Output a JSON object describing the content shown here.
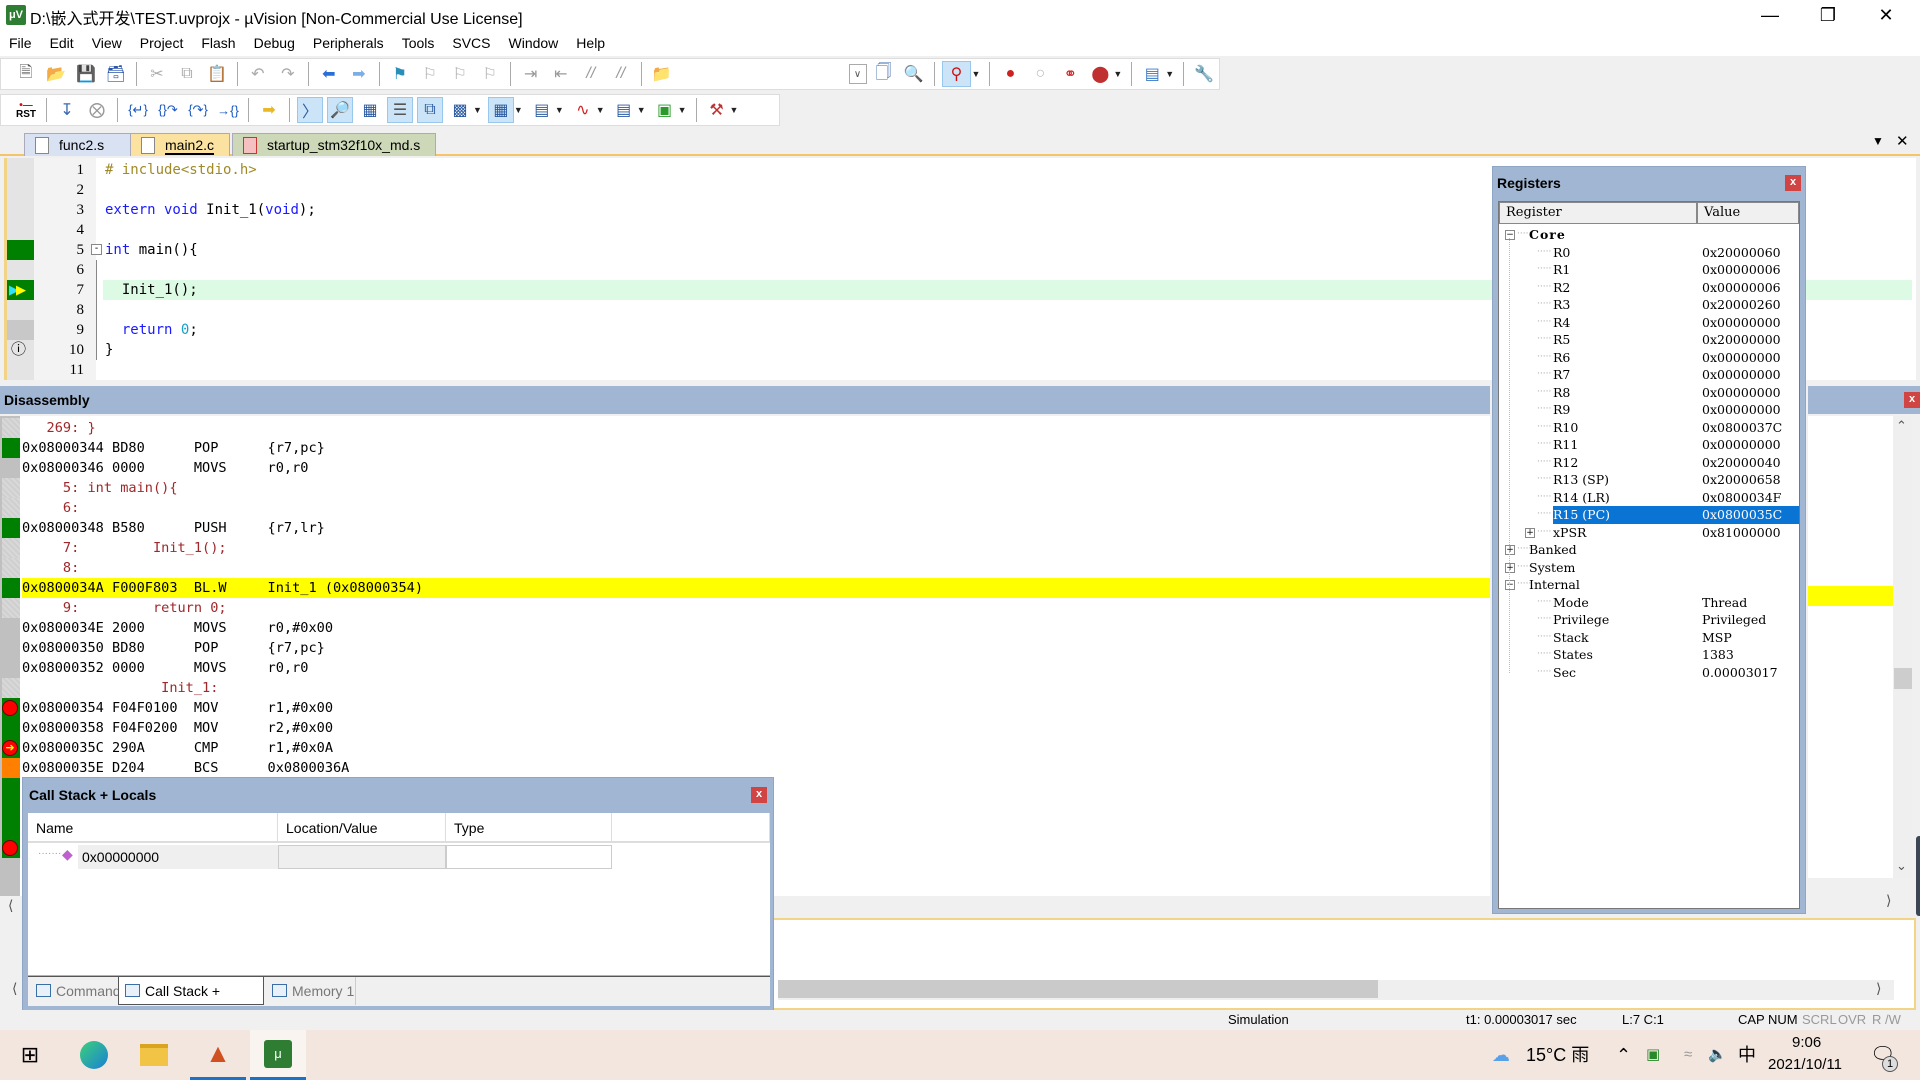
{
  "window": {
    "app_icon": "uvision-icon",
    "title": "D:\\嵌入式开发\\TEST.uvprojx - µVision  [Non-Commercial Use License]",
    "controls": [
      "minimize",
      "restore",
      "close"
    ]
  },
  "menubar": {
    "items": [
      "File",
      "Edit",
      "View",
      "Project",
      "Flash",
      "Debug",
      "Peripherals",
      "Tools",
      "SVCS",
      "Window",
      "Help"
    ]
  },
  "toolbar_file": {
    "icons": [
      "new-file-icon",
      "open-folder-icon",
      "save-icon",
      "save-all-icon",
      "cut-icon",
      "copy-icon",
      "paste-icon",
      "undo-icon",
      "redo-icon",
      "nav-back-icon",
      "nav-forward-icon",
      "bookmark-icon",
      "prev-bookmark-icon",
      "next-bookmark-icon",
      "clear-bookmarks-icon",
      "indent-icon",
      "unindent-icon",
      "comment-icon",
      "uncomment-icon",
      "find-in-files-icon",
      "find-combo",
      "incremental-find-icon",
      "find-icon",
      "debug-session-icon",
      "breakpoint-insert-icon",
      "breakpoint-disable-icon",
      "breakpoint-disable-all-icon",
      "breakpoint-kill-all-icon",
      "window-layout-icon",
      "configure-icon"
    ]
  },
  "toolbar_debug": {
    "icons": [
      "reset-icon",
      "run-icon",
      "stop-icon",
      "step-into-icon",
      "step-over-icon",
      "step-out-icon",
      "run-to-cursor-icon",
      "show-next-statement-icon",
      "command-window-icon",
      "disassembly-window-icon",
      "symbols-window-icon",
      "registers-window-icon",
      "call-stack-window-icon",
      "watch-window-icon",
      "memory-window-icon",
      "serial-window-icon",
      "analysis-window-icon",
      "trace-window-icon",
      "system-viewer-icon",
      "toolbox-icon"
    ],
    "reset_label": "RST"
  },
  "file_tabs": [
    {
      "label": "func2.s",
      "active": false
    },
    {
      "label": "main2.c",
      "active": true
    },
    {
      "label": "startup_stm32f10x_md.s",
      "active": false
    }
  ],
  "editor": {
    "lines": [
      {
        "n": "1",
        "segments": [
          {
            "t": "# include<stdio.h>",
            "c": "pp"
          }
        ]
      },
      {
        "n": "2",
        "segments": []
      },
      {
        "n": "3",
        "segments": [
          {
            "t": "extern void ",
            "c": "kw"
          },
          {
            "t": "Init_1(",
            "c": ""
          },
          {
            "t": "void",
            "c": "kw"
          },
          {
            "t": ");",
            "c": ""
          }
        ]
      },
      {
        "n": "4",
        "segments": []
      },
      {
        "n": "5",
        "segments": [
          {
            "t": "int ",
            "c": "kw"
          },
          {
            "t": "main(){",
            "c": ""
          }
        ]
      },
      {
        "n": "6",
        "segments": []
      },
      {
        "n": "7",
        "segments": [
          {
            "t": "  Init_1();",
            "c": ""
          }
        ],
        "current": true
      },
      {
        "n": "8",
        "segments": []
      },
      {
        "n": "9",
        "segments": [
          {
            "t": "  ",
            "c": ""
          },
          {
            "t": "return ",
            "c": "kw"
          },
          {
            "t": "0",
            "c": "num"
          },
          {
            "t": ";",
            "c": ""
          }
        ]
      },
      {
        "n": "10",
        "segments": [
          {
            "t": "}",
            "c": ""
          }
        ]
      },
      {
        "n": "11",
        "segments": []
      }
    ],
    "gutter_marks": {
      "5": "executed",
      "7": "current-pc",
      "9": "not-executed",
      "10": "warning"
    }
  },
  "disassembly": {
    "title": "Disassembly",
    "lines": [
      {
        "kind": "src",
        "text": "   269: }",
        "mark": "none"
      },
      {
        "kind": "asm",
        "text": "0x08000344 BD80      POP      {r7,pc}",
        "mark": "exec"
      },
      {
        "kind": "asm",
        "text": "0x08000346 0000      MOVS     r0,r0",
        "mark": "gray"
      },
      {
        "kind": "src",
        "text": "     5: int main(){",
        "mark": "none"
      },
      {
        "kind": "src",
        "text": "     6: ",
        "mark": "none"
      },
      {
        "kind": "asm",
        "text": "0x08000348 B580      PUSH     {r7,lr}",
        "mark": "exec"
      },
      {
        "kind": "src",
        "text": "     7:         Init_1();",
        "mark": "none"
      },
      {
        "kind": "src",
        "text": "     8: ",
        "mark": "none"
      },
      {
        "kind": "asm",
        "text": "0x0800034A F000F803  BL.W     Init_1 (0x08000354)",
        "mark": "exec",
        "current": true
      },
      {
        "kind": "src",
        "text": "     9:         return 0;",
        "mark": "none"
      },
      {
        "kind": "asm",
        "text": "0x0800034E 2000      MOVS     r0,#0x00",
        "mark": "gray"
      },
      {
        "kind": "asm",
        "text": "0x08000350 BD80      POP      {r7,pc}",
        "mark": "gray"
      },
      {
        "kind": "asm",
        "text": "0x08000352 0000      MOVS     r0,r0",
        "mark": "gray"
      },
      {
        "kind": "src",
        "text": "                 Init_1:",
        "mark": "none"
      },
      {
        "kind": "asm",
        "text": "0x08000354 F04F0100  MOV      r1,#0x00",
        "mark": "breakpoint"
      },
      {
        "kind": "asm",
        "text": "0x08000358 F04F0200  MOV      r2,#0x00",
        "mark": "exec"
      },
      {
        "kind": "asm",
        "text": "0x0800035C 290A      CMP      r1,#0x0A",
        "mark": "breakpoint-pc"
      },
      {
        "kind": "asm",
        "text": "0x0800035E D204      BCS      0x0800036A",
        "mark": "branch"
      }
    ]
  },
  "registers": {
    "title": "Registers",
    "columns": [
      "Register",
      "Value"
    ],
    "groups": [
      {
        "name": "Core",
        "expanded": true,
        "items": [
          {
            "name": "R0",
            "value": "0x20000060"
          },
          {
            "name": "R1",
            "value": "0x00000006"
          },
          {
            "name": "R2",
            "value": "0x00000006"
          },
          {
            "name": "R3",
            "value": "0x20000260"
          },
          {
            "name": "R4",
            "value": "0x00000000"
          },
          {
            "name": "R5",
            "value": "0x20000000"
          },
          {
            "name": "R6",
            "value": "0x00000000"
          },
          {
            "name": "R7",
            "value": "0x00000000"
          },
          {
            "name": "R8",
            "value": "0x00000000"
          },
          {
            "name": "R9",
            "value": "0x00000000"
          },
          {
            "name": "R10",
            "value": "0x0800037C"
          },
          {
            "name": "R11",
            "value": "0x00000000"
          },
          {
            "name": "R12",
            "value": "0x20000040"
          },
          {
            "name": "R13 (SP)",
            "value": "0x20000658"
          },
          {
            "name": "R14 (LR)",
            "value": "0x0800034F"
          },
          {
            "name": "R15 (PC)",
            "value": "0x0800035C",
            "selected": true
          },
          {
            "name": "xPSR",
            "value": "0x81000000",
            "expandable": true
          }
        ]
      },
      {
        "name": "Banked",
        "expanded": false,
        "items": []
      },
      {
        "name": "System",
        "expanded": false,
        "items": []
      },
      {
        "name": "Internal",
        "expanded": true,
        "items": [
          {
            "name": "Mode",
            "value": "Thread"
          },
          {
            "name": "Privilege",
            "value": "Privileged"
          },
          {
            "name": "Stack",
            "value": "MSP"
          },
          {
            "name": "States",
            "value": "1383"
          },
          {
            "name": "Sec",
            "value": "0.00003017"
          }
        ]
      }
    ]
  },
  "callstack": {
    "title": "Call Stack + Locals",
    "columns": [
      "Name",
      "Location/Value",
      "Type"
    ],
    "rows": [
      {
        "name": "0x00000000",
        "location": "",
        "type": ""
      }
    ],
    "tabs": [
      {
        "label": "Command",
        "active": false
      },
      {
        "label": "Call Stack + Locals",
        "active": true
      },
      {
        "label": "Memory 1",
        "active": false
      }
    ]
  },
  "statusbar": {
    "mode": "Simulation",
    "timer": "t1: 0.00003017 sec",
    "position": "L:7 C:1",
    "indicators": [
      {
        "label": "CAP",
        "on": true
      },
      {
        "label": "NUM",
        "on": true
      },
      {
        "label": "SCRL",
        "on": false
      },
      {
        "label": "OVR",
        "on": false
      },
      {
        "label": "R /W",
        "on": false
      }
    ]
  },
  "taskbar": {
    "apps": [
      "windows-start-icon",
      "edge-icon",
      "file-explorer-icon",
      "matlab-icon",
      "keil-uvision-icon"
    ],
    "weather": "15°C 雨",
    "ime": "中",
    "time": "9:06",
    "date": "2021/10/11",
    "notifications": "1"
  },
  "colors": {
    "panel_header": "#a0b6d2",
    "current_line": "#ffff00",
    "editor_current": "#ddfbe4",
    "executed": "#008000",
    "not_executed": "#c0c0c0",
    "branch": "#ff8000",
    "selection": "#0a74d4"
  }
}
